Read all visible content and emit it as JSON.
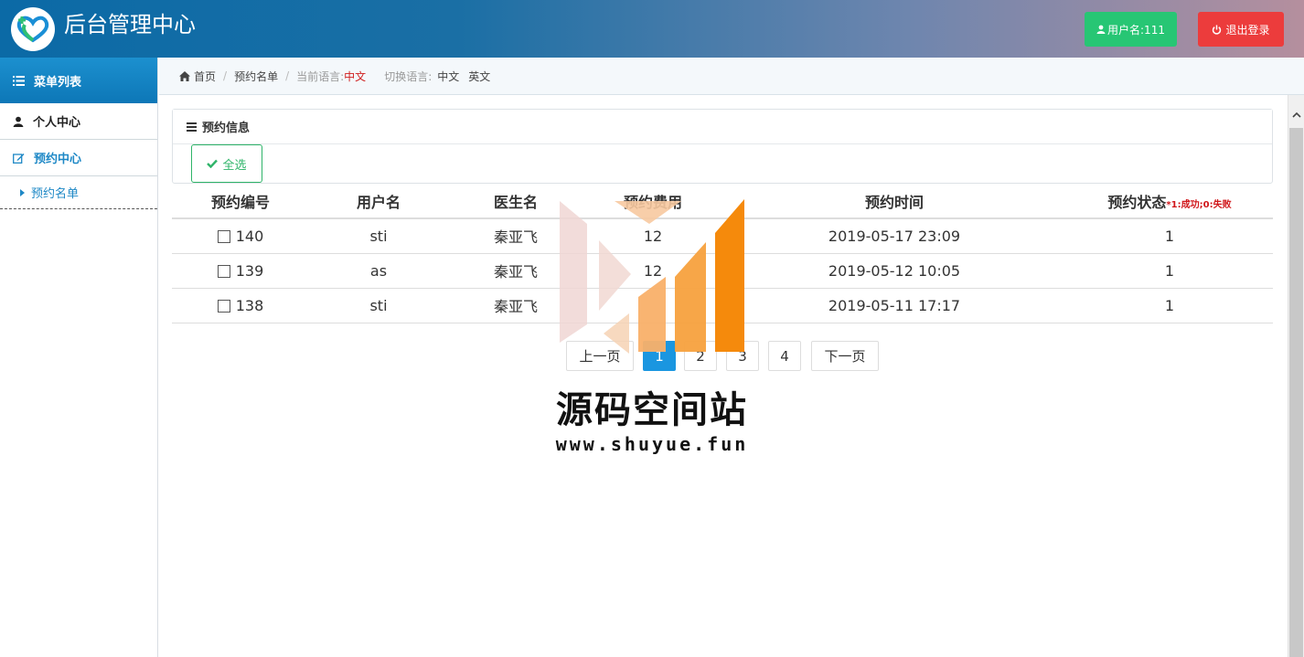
{
  "header": {
    "title": "后台管理中心",
    "user_label": "用户名:111",
    "logout_label": "退出登录"
  },
  "sidebar": {
    "heading": "菜单列表",
    "items": [
      {
        "label": "个人中心"
      },
      {
        "label": "预约中心"
      }
    ],
    "sub_items": [
      {
        "label": "预约名单"
      }
    ]
  },
  "breadcrumb": {
    "home": "首页",
    "page": "预约名单",
    "current_lang_label": "当前语言:",
    "current_lang": "中文",
    "switch_label": "切换语言:",
    "lang_zh": "中文",
    "lang_en": "英文"
  },
  "panel": {
    "title": "预约信息",
    "select_all": "全选"
  },
  "table": {
    "headers": [
      "预约编号",
      "用户名",
      "医生名",
      "预约费用",
      "预约时间",
      "预约状态"
    ],
    "status_note": "*1:成功;0:失败",
    "rows": [
      {
        "id": "140",
        "user": "sti",
        "doctor": "秦亚飞",
        "fee": "12",
        "time": "2019-05-17 23:09",
        "status": "1"
      },
      {
        "id": "139",
        "user": "as",
        "doctor": "秦亚飞",
        "fee": "12",
        "time": "2019-05-12 10:05",
        "status": "1"
      },
      {
        "id": "138",
        "user": "sti",
        "doctor": "秦亚飞",
        "fee": "",
        "time": "2019-05-11 17:17",
        "status": "1"
      }
    ]
  },
  "pager": {
    "prev": "上一页",
    "pages": [
      "1",
      "2",
      "3",
      "4"
    ],
    "next": "下一页",
    "current": "1"
  },
  "watermark": {
    "name": "源码空间站",
    "url": "www.shuyue.fun"
  },
  "colors": {
    "header_start": "#0b6aa6",
    "user_button": "#27c674",
    "logout_button": "#ec3c3c",
    "accent_blue": "#1e88c6",
    "active_page": "#1a96e0",
    "note_red": "#d0161a"
  }
}
